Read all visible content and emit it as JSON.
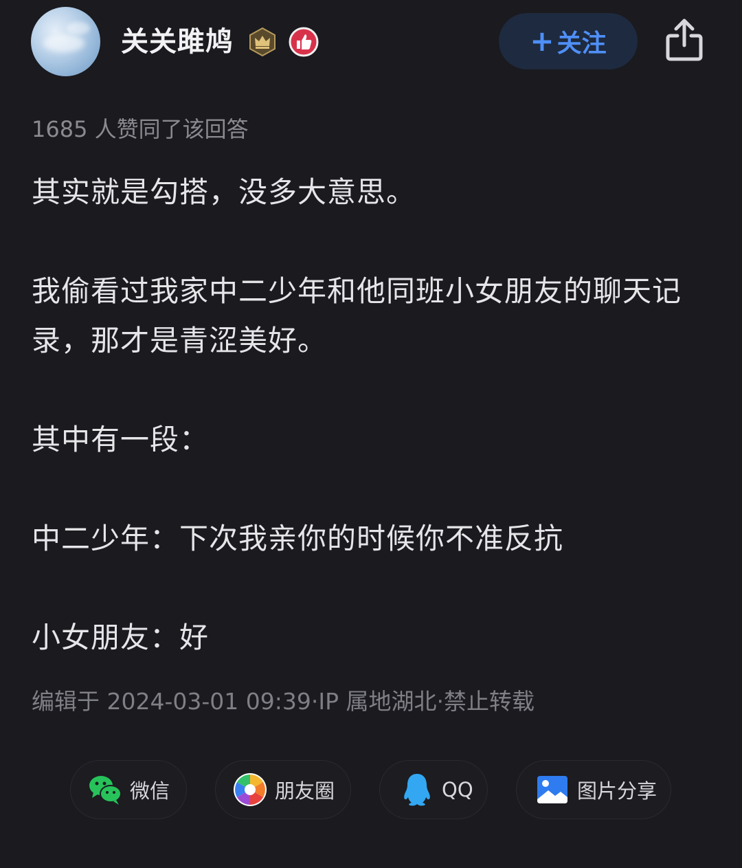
{
  "author": {
    "name": "关关雎鸠",
    "badges": [
      "crown-badge",
      "thumbs-up-badge"
    ]
  },
  "follow_button": {
    "plus": "+",
    "label": "关注"
  },
  "likes_text": "1685 人赞同了该回答",
  "paragraphs": [
    "其实就是勾搭，没多大意思。",
    "我偷看过我家中二少年和他同班小女朋友的聊天记录，那才是青涩美好。",
    "其中有一段：",
    "中二少年：下次我亲你的时候你不准反抗",
    "小女朋友：好"
  ],
  "meta_text": "编辑于 2024-03-01 09:39·IP 属地湖北·禁止转载",
  "share": {
    "items": [
      {
        "label": "微信",
        "icon": "wechat-icon"
      },
      {
        "label": "朋友圈",
        "icon": "moments-icon"
      },
      {
        "label": "QQ",
        "icon": "qq-icon"
      },
      {
        "label": "图片分享",
        "icon": "image-share-icon"
      }
    ]
  },
  "colors": {
    "background": "#1a1a1f",
    "accent": "#4f8ff7",
    "follow_bg": "#1e2a3f",
    "muted_text": "#8a8a90"
  }
}
